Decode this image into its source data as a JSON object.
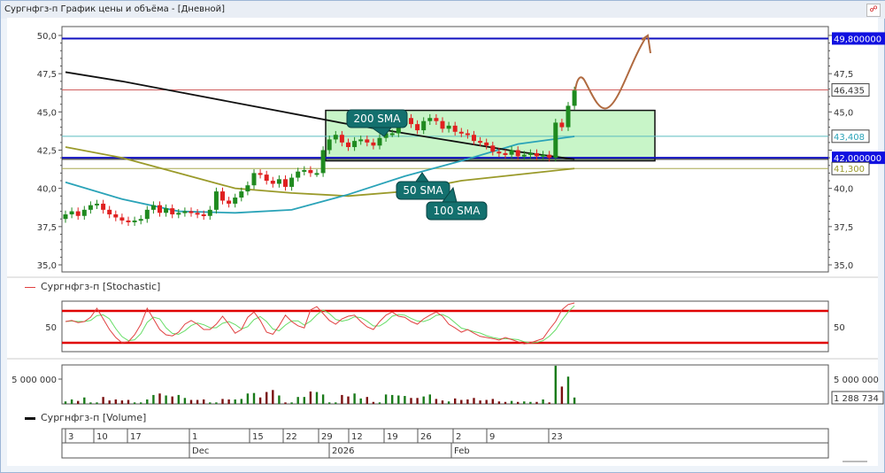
{
  "window": {
    "title": "Сургнфгз-п График цены и объёма - [Дневной]",
    "pin_icon": "pin-icon"
  },
  "colors": {
    "up": "#1f8a1f",
    "down": "#e02020",
    "vol_up": "#1a7a1a",
    "vol_down": "#7a1010",
    "sma200": "#111111",
    "sma50": "#2aa3b8",
    "sma100": "#9a9a2a",
    "level_blue": "#1010c0",
    "stoch_k": "#e04040",
    "stoch_d": "#66dd66",
    "zone": "#c8f5c8",
    "callout": "#13706e",
    "sketch": "#b06a40"
  },
  "price_axis": {
    "ticks": [
      "35,0",
      "37,5",
      "40,0",
      "42,5",
      "45,0",
      "47,5",
      "50,0"
    ]
  },
  "levels": [
    {
      "value": 49.8,
      "label": "49,800000",
      "kind": "blue"
    },
    {
      "value": 46.435,
      "label": "46,435",
      "kind": "red"
    },
    {
      "value": 43.408,
      "label": "43,408",
      "kind": "teal"
    },
    {
      "value": 42.0,
      "label": "42,000000",
      "kind": "blue"
    },
    {
      "value": 41.3,
      "label": "41,300",
      "kind": "olive"
    }
  ],
  "annotations": {
    "sma200": "200 SMA",
    "sma50": "50 SMA",
    "sma100": "100 SMA",
    "zone_top": 45.1,
    "zone_bottom": 41.8
  },
  "stochastic": {
    "legend": "Сургнфгз-п [Stochastic]",
    "tick": "50",
    "upper": 80,
    "lower": 20
  },
  "volume": {
    "legend": "Сургнфгз-п [Volume]",
    "tick": "5 000 000",
    "last_label": "1 288 734"
  },
  "date_axis": {
    "days": [
      "3",
      "10",
      "17",
      "1",
      "15",
      "22",
      "29",
      "12",
      "19",
      "26",
      "2",
      "9",
      "23"
    ],
    "months": [
      "Dec",
      "2026",
      "Feb"
    ]
  },
  "chart_data": {
    "type": "candlestick",
    "ylim": [
      35,
      50
    ],
    "close": [
      38.3,
      38.5,
      38.2,
      38.6,
      38.9,
      39.0,
      38.6,
      38.3,
      38.1,
      37.9,
      37.8,
      37.9,
      38.0,
      38.6,
      38.9,
      38.4,
      38.7,
      38.3,
      38.4,
      38.5,
      38.4,
      38.3,
      38.2,
      38.6,
      39.8,
      39.2,
      39.0,
      39.4,
      39.8,
      40.2,
      41.0,
      40.9,
      40.5,
      40.3,
      40.6,
      40.1,
      40.7,
      41.1,
      41.2,
      41.0,
      41.0,
      42.5,
      43.2,
      43.5,
      43.0,
      42.7,
      43.1,
      43.2,
      43.0,
      42.8,
      43.3,
      43.6,
      43.6,
      44.3,
      44.6,
      44.2,
      43.8,
      44.4,
      44.6,
      44.4,
      43.9,
      44.1,
      43.7,
      43.6,
      43.5,
      43.1,
      43.0,
      42.8,
      42.4,
      42.3,
      42.2,
      42.5,
      42.1,
      42.2,
      42.3,
      42.1,
      42.2,
      42.0,
      44.3,
      44.0,
      45.4,
      46.4
    ],
    "sma200": [
      47.6,
      47.0,
      46.3,
      45.6,
      44.9,
      44.2,
      43.6,
      43.0,
      42.4,
      41.9
    ],
    "sma50": [
      40.4,
      39.3,
      38.5,
      38.4,
      38.6,
      39.6,
      40.8,
      41.8,
      42.9,
      43.4
    ],
    "sma100": [
      42.7,
      42.0,
      41.0,
      40.0,
      39.7,
      39.5,
      39.8,
      40.5,
      40.9,
      41.3
    ],
    "stoch_k": [
      60,
      62,
      58,
      60,
      68,
      85,
      65,
      45,
      30,
      20,
      22,
      35,
      55,
      85,
      65,
      45,
      35,
      33,
      40,
      55,
      62,
      55,
      45,
      45,
      55,
      70,
      55,
      38,
      45,
      68,
      78,
      62,
      40,
      36,
      52,
      72,
      60,
      52,
      48,
      82,
      88,
      75,
      62,
      55,
      65,
      70,
      72,
      60,
      50,
      45,
      60,
      72,
      78,
      70,
      68,
      60,
      55,
      65,
      72,
      78,
      70,
      55,
      48,
      40,
      45,
      38,
      32,
      30,
      28,
      25,
      30,
      26,
      22,
      18,
      20,
      24,
      28,
      45,
      60,
      82,
      92,
      95
    ],
    "volume": [
      500000,
      900000,
      600000,
      1300000,
      300000,
      300000,
      1400000,
      700000,
      900000,
      700000,
      800000,
      300000,
      300000,
      900000,
      1800000,
      2100000,
      1700000,
      1500000,
      1800000,
      1200000,
      800000,
      800000,
      900000,
      300000,
      300000,
      1000000,
      900000,
      900000,
      1000000,
      2100000,
      2200000,
      1300000,
      2400000,
      2800000,
      1700000,
      300000,
      300000,
      1400000,
      1400000,
      2500000,
      2400000,
      1900000,
      300000,
      300000,
      1800000,
      1500000,
      2100000,
      1100000,
      1400000,
      400000,
      300000,
      1900000,
      1800000,
      1700000,
      1600000,
      1200000,
      1200000,
      1500000,
      1900000,
      1000000,
      700000,
      500000,
      1100000,
      800000,
      900000,
      1200000,
      700000,
      800000,
      1000000,
      500000,
      400000,
      600000,
      400000,
      500000,
      400000,
      400000,
      900000,
      300000,
      7700000,
      3500000,
      5500000,
      1288734
    ]
  }
}
